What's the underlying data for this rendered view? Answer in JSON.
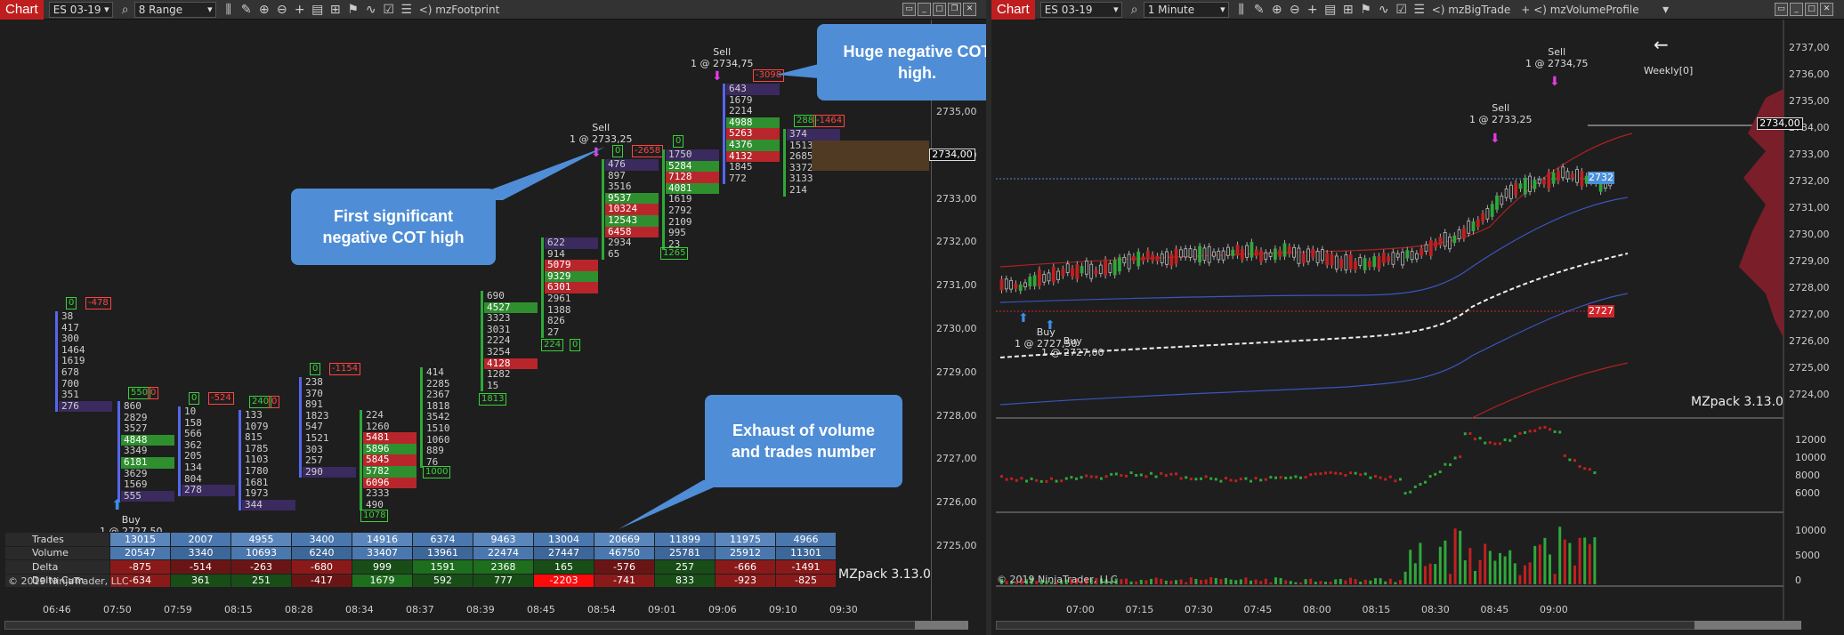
{
  "left": {
    "chart_button": "Chart",
    "instrument": "ES 03-19",
    "period": "8 Range",
    "indicator": "mzFootprint",
    "price_labels": [
      "2735,00",
      "2734,00",
      "2733,00",
      "2732,00",
      "2731,00",
      "2730,00",
      "2729,00",
      "2728,00",
      "2727,00",
      "2726,00",
      "2725,00"
    ],
    "current_price": "2734,00",
    "time_labels": [
      "06:46",
      "07:50",
      "07:59",
      "08:15",
      "08:28",
      "08:34",
      "08:37",
      "08:39",
      "08:45",
      "08:54",
      "09:01",
      "09:06",
      "09:10",
      "09:30"
    ],
    "copyright": "© 2019 NinjaTrader, LLC",
    "watermark": "MZpack 3.13.0",
    "callout1": "First significant negative COT high",
    "callout2": "Huge negative COT high.",
    "callout3": "Exhaust of volume and trades number",
    "buy_label": "Buy",
    "buy_detail": "1 @ 2727,50",
    "sell1_label": "Sell",
    "sell1_detail": "1 @ 2733,25",
    "sell2_label": "Sell",
    "sell2_detail": "1 @ 2734,75",
    "stats_rows": [
      {
        "label": "Trades",
        "values": [
          "13015",
          "2007",
          "4955",
          "3400",
          "14916",
          "6374",
          "9463",
          "13004",
          "20669",
          "11899",
          "11975",
          "4966"
        ]
      },
      {
        "label": "Volume",
        "values": [
          "20547",
          "3340",
          "10693",
          "6240",
          "33407",
          "13961",
          "22474",
          "27447",
          "46750",
          "25781",
          "25912",
          "11301"
        ]
      },
      {
        "label": "Delta",
        "values": [
          "-875",
          "-514",
          "-263",
          "-680",
          "999",
          "1591",
          "2368",
          "165",
          "-576",
          "257",
          "-666",
          "-1491"
        ]
      },
      {
        "label": "Delta Cum",
        "values": [
          "-634",
          "361",
          "251",
          "-417",
          "1679",
          "592",
          "777",
          "-2203",
          "-741",
          "833",
          "-923",
          "-825"
        ]
      }
    ],
    "columns": [
      {
        "top_mark": "0",
        "top_neg": "-478",
        "cells": [
          "38",
          "417",
          "300",
          "1464",
          "1619",
          "678",
          "700",
          "351",
          "276"
        ]
      },
      {
        "top_mark": "550",
        "top_neg": "0",
        "cells": [
          "860",
          "2829",
          "3527",
          "4848",
          "3349",
          "6181",
          "3629",
          "1569",
          "555"
        ]
      },
      {
        "top_mark": "0",
        "top_neg": "-524",
        "cells": [
          "10",
          "158",
          "566",
          "362",
          "205",
          "134",
          "804",
          "278"
        ]
      },
      {
        "top_mark": "240",
        "top_neg": "0",
        "cells": [
          "133",
          "1079",
          "815",
          "1785",
          "1103",
          "1780",
          "1681",
          "1973",
          "344"
        ]
      },
      {
        "top_mark": "0",
        "top_neg": "-1154",
        "cells": [
          "238",
          "370",
          "891",
          "1823",
          "547",
          "1521",
          "303",
          "257",
          "290"
        ]
      },
      {
        "top_mark": "",
        "top_neg": "",
        "cells": [
          "224",
          "1260",
          "5481",
          "5896",
          "5845",
          "5782",
          "6096",
          "2333",
          "490"
        ]
      },
      {
        "top_mark": "",
        "top_neg": "",
        "cells": [
          "414",
          "2285",
          "2367",
          "1818",
          "3542",
          "1510",
          "1060",
          "889",
          "76"
        ]
      },
      {
        "top_mark": "",
        "top_neg": "",
        "cells": [
          "690",
          "4527",
          "3323",
          "3031",
          "2224",
          "3254",
          "4128",
          "1282",
          "15"
        ]
      },
      {
        "top_mark": "",
        "top_neg": "",
        "cells": [
          "622",
          "914",
          "5079",
          "9329",
          "6301",
          "2961",
          "1388",
          "826",
          "27"
        ]
      },
      {
        "top_mark": "0",
        "top_neg": "-2658",
        "cells": [
          "476",
          "897",
          "3516",
          "9537",
          "10324",
          "12543",
          "6458",
          "2934",
          "65"
        ]
      },
      {
        "top_mark": "0",
        "top_neg": "",
        "cells": [
          "1750",
          "5284",
          "7128",
          "4081",
          "1619",
          "2792",
          "2109",
          "995",
          "23"
        ]
      },
      {
        "top_mark": "",
        "top_neg": "-3098",
        "cells": [
          "643",
          "1679",
          "2214",
          "4988",
          "5263",
          "4376",
          "4132",
          "1845",
          "772"
        ]
      },
      {
        "top_mark": "288",
        "top_neg": "-1464",
        "cells": [
          "374",
          "1513",
          "2685",
          "3372",
          "3133",
          "214"
        ]
      }
    ],
    "bottom_marks": [
      "1078",
      "1000",
      "1813",
      "224",
      "0",
      "1265"
    ]
  },
  "right": {
    "chart_button": "Chart",
    "instrument": "ES 03-19",
    "period": "1 Minute",
    "indicator1": "mzBigTrade",
    "indicator2": "mzVolumeProfile",
    "price_labels": [
      "2737,00",
      "2736,00",
      "2735,00",
      "2734,00",
      "2733,00",
      "2732,00",
      "2731,00",
      "2730,00",
      "2729,00",
      "2728,00",
      "2727,00",
      "2726,00",
      "2725,00",
      "2724,00"
    ],
    "current_price": "2734,00",
    "level_2732": "2732",
    "level_2727": "2727",
    "weekly_label": "Weekly[0]",
    "watermark": "MZpack 3.13.0",
    "copyright": "© 2019 NinjaTrader, LLC",
    "time_labels": [
      "07:00",
      "07:15",
      "07:30",
      "07:45",
      "08:00",
      "08:15",
      "08:30",
      "08:45",
      "09:00"
    ],
    "osc_labels": [
      "12000",
      "10000",
      "8000",
      "6000"
    ],
    "vol_labels": [
      "10000",
      "5000",
      "0"
    ],
    "buy1_label": "Buy",
    "buy1_detail": "1 @ 2727,50",
    "buy2_label": "Buy",
    "buy2_detail": "1 @ 2727,00",
    "sell1_label": "Sell",
    "sell1_detail": "1 @ 2733,25",
    "sell2_label": "Sell",
    "sell2_detail": "1 @ 2734,75"
  },
  "colors": {
    "bid": "#b8262b",
    "ask": "#2f8f2f",
    "accent": "#c01e1e",
    "callout": "#4f8ed6"
  }
}
